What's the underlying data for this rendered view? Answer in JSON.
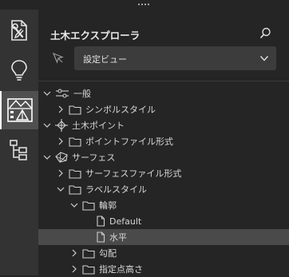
{
  "panel": {
    "title": "土木エクスプローラ",
    "dropdown_value": "設定ビュー"
  },
  "tree": [
    {
      "label": "一般",
      "icon": "settings-sliders-icon",
      "indent": 0,
      "expanded": true,
      "leaf": false
    },
    {
      "label": "シンボルスタイル",
      "icon": "folder-icon",
      "indent": 1,
      "expanded": false,
      "leaf": false
    },
    {
      "label": "土木ポイント",
      "icon": "crosshair-point-icon",
      "indent": 0,
      "expanded": true,
      "leaf": false
    },
    {
      "label": "ポイントファイル形式",
      "icon": "folder-icon",
      "indent": 1,
      "expanded": false,
      "leaf": false
    },
    {
      "label": "サーフェス",
      "icon": "surface-icon",
      "indent": 0,
      "expanded": true,
      "leaf": false
    },
    {
      "label": "サーフェスファイル形式",
      "icon": "folder-icon",
      "indent": 1,
      "expanded": false,
      "leaf": false
    },
    {
      "label": "ラベルスタイル",
      "icon": "folder-icon",
      "indent": 1,
      "expanded": true,
      "leaf": false
    },
    {
      "label": "輪郭",
      "icon": "folder-icon",
      "indent": 2,
      "expanded": true,
      "leaf": false
    },
    {
      "label": "Default",
      "icon": "document-icon",
      "indent": 3,
      "expanded": false,
      "leaf": true
    },
    {
      "label": "水平",
      "icon": "document-icon",
      "indent": 3,
      "expanded": false,
      "leaf": true,
      "selected": true
    },
    {
      "label": "勾配",
      "icon": "folder-icon",
      "indent": 2,
      "expanded": false,
      "leaf": false
    },
    {
      "label": "指定点高さ",
      "icon": "folder-icon",
      "indent": 2,
      "expanded": false,
      "leaf": false
    }
  ]
}
